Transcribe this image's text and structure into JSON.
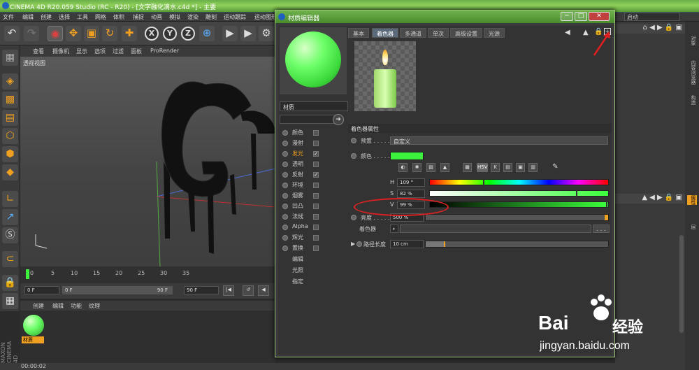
{
  "window": {
    "title": "CINEMA 4D R20.059 Studio (RC - R20) - [文字融化滴水.c4d *] - 主要"
  },
  "menu": [
    "文件",
    "编辑",
    "创建",
    "选择",
    "工具",
    "网格",
    "体积",
    "捕捉",
    "动画",
    "模拟",
    "渲染",
    "雕刻",
    "运动跟踪",
    "运动图形"
  ],
  "right_dropdown": "启动",
  "viewport": {
    "menu": [
      "查看",
      "摄像机",
      "显示",
      "选项",
      "过滤",
      "面板",
      "ProRender"
    ],
    "label": "透视视图"
  },
  "timeline": {
    "ticks": [
      "0",
      "5",
      "10",
      "15",
      "20",
      "25",
      "30",
      "35"
    ],
    "start": "0 F",
    "start2": "0 F",
    "end": "90 F",
    "end2": "90 F"
  },
  "mat_manager": {
    "menu": [
      "创建",
      "编辑",
      "功能",
      "纹理"
    ],
    "item": "材质"
  },
  "status": "00:00:02",
  "editor": {
    "title": "材质编辑器",
    "material_name": "材质",
    "tabs": [
      "基本",
      "着色器",
      "多通道",
      "单次",
      "高级设置",
      "光源"
    ],
    "active_tab": "着色器",
    "channels": [
      {
        "label": "颜色",
        "checked": false
      },
      {
        "label": "漫射",
        "checked": false
      },
      {
        "label": "发光",
        "checked": true,
        "highlight": true
      },
      {
        "label": "透明",
        "checked": false
      },
      {
        "label": "反射",
        "checked": true
      },
      {
        "label": "环境",
        "checked": false
      },
      {
        "label": "烟雾",
        "checked": false
      },
      {
        "label": "凹凸",
        "checked": false
      },
      {
        "label": "法线",
        "checked": false
      },
      {
        "label": "Alpha",
        "checked": false
      },
      {
        "label": "辉光",
        "checked": false
      },
      {
        "label": "置换",
        "checked": false
      }
    ],
    "extras": [
      "编辑",
      "光照",
      "指定"
    ],
    "section": "着色器属性",
    "preset_label": "预置 . . . . .",
    "preset_value": "自定义",
    "color_label": "颜色 . . . . .",
    "color_swatch": "#3cf23c",
    "hsv_button": "HSV",
    "h_label": "H",
    "h_value": "109 °",
    "s_label": "S",
    "s_value": "82 %",
    "v_label": "V",
    "v_value": "99 %",
    "brightness_label": "亮度 . . . . .",
    "brightness_value": "500 %",
    "shader_label": "着色器",
    "shader_btn": ". . .",
    "path_label": "路径长度",
    "path_value": "10 cm"
  },
  "watermark": {
    "brand": "Bai",
    "brand2": "经验",
    "url": "jingyan.baidu.com"
  },
  "side_tabs": [
    "对象",
    "内容浏览器",
    "构造",
    "属性",
    "层"
  ],
  "colors": {
    "accent": "#f0a020",
    "title_green": "#6fb24c",
    "annotation": "#e02020"
  }
}
